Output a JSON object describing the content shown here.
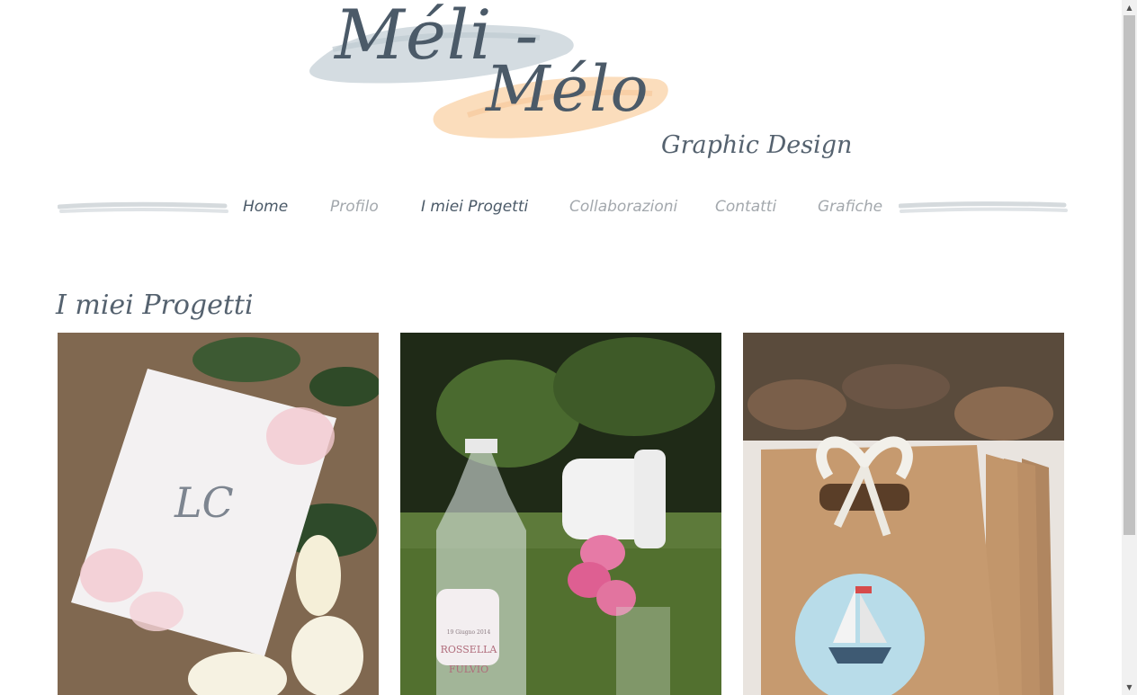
{
  "logo": {
    "line1": "Méli -",
    "line2": "Mélo",
    "subtitle": "Graphic Design"
  },
  "nav": {
    "items": [
      {
        "label": "Home"
      },
      {
        "label": "Profilo"
      },
      {
        "label": "I miei Progetti"
      },
      {
        "label": "Collaborazioni"
      },
      {
        "label": "Contatti"
      },
      {
        "label": "Grafiche"
      }
    ]
  },
  "section": {
    "title": "I miei Progetti"
  },
  "projects": [
    {
      "image": "wedding-invitation-roses-photo",
      "monogram": "LC"
    },
    {
      "image": "bottle-and-flowers-photo",
      "bottle_label_date": "19 Giugno 2014",
      "bottle_label_names": [
        "ROSSELLA",
        "FULVIO"
      ]
    },
    {
      "image": "kraft-gift-bags-sailboat-photo"
    }
  ],
  "colors": {
    "text_dark": "#4b5a68",
    "nav_inactive": "#a3a8ad",
    "logo_brush_blue": "#cfd8de",
    "logo_brush_peach": "#fbd9b5"
  }
}
